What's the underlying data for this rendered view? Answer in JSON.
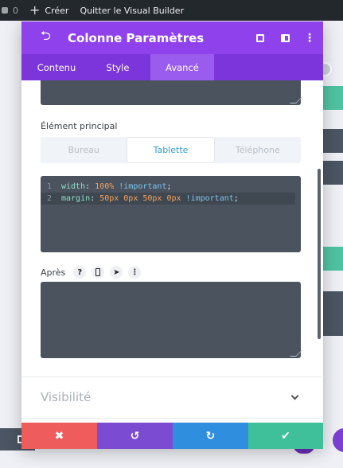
{
  "adminbar": {
    "comment_count": "0",
    "new_label": "Créer",
    "quit_label": "Quitter le Visual Builder"
  },
  "modal": {
    "title": "Colonne Paramètres",
    "tabs": [
      "Contenu",
      "Style",
      "Avancé"
    ],
    "active_tab": "Avancé",
    "element_principal_label": "Élément principal",
    "device_tabs": [
      "Bureau",
      "Tablette",
      "Téléphone"
    ],
    "active_device": "Tablette",
    "code_lines": [
      {
        "num": "1",
        "prop": "width",
        "colon": ": ",
        "value": "100%",
        "imp": " !important",
        "semi": ";"
      },
      {
        "num": "2",
        "prop": "margin",
        "colon": ": ",
        "value": "50px 0px 50px 0px",
        "imp": " !important",
        "semi": ";"
      }
    ],
    "apres_label": "Après",
    "help_icon": "?",
    "visibility_label": "Visibilité"
  },
  "colors": {
    "header": "#8f42ec",
    "tabs_bar": "#7b35da",
    "cancel": "#ef5c5c",
    "undo": "#7b4bd1",
    "redo": "#2f8fde",
    "save": "#3fc09a",
    "active_device": "#2e9bd6"
  },
  "icons": {
    "back": "back-arrow-icon",
    "expand": "expand-icon",
    "split": "split-view-icon",
    "more": "more-vertical-icon",
    "cancel": "close-icon",
    "undo": "undo-icon",
    "redo": "redo-icon",
    "save": "check-icon"
  }
}
